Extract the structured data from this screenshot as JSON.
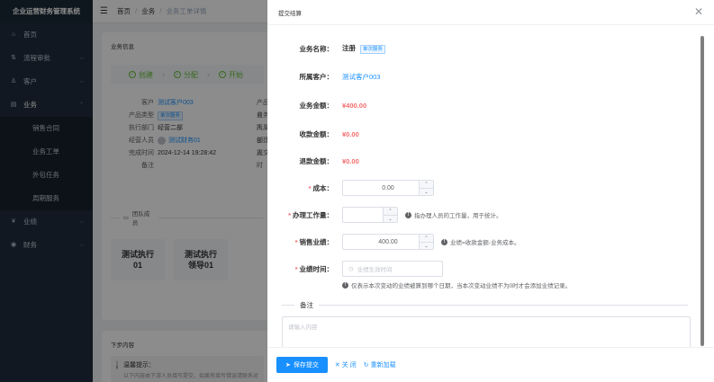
{
  "sidebar": {
    "brand": "企业运营财务管理系统",
    "items": [
      {
        "icon": "⌂",
        "label": "首页"
      },
      {
        "icon": "⇅",
        "label": "流程审批"
      },
      {
        "icon": "♙",
        "label": "客户"
      },
      {
        "icon": "▤",
        "label": "业务"
      }
    ],
    "sub_items": [
      "销售合同",
      "业务工单",
      "外包任务",
      "周期服务"
    ],
    "bottom_items": [
      {
        "icon": "¥",
        "label": "业绩"
      },
      {
        "icon": "◉",
        "label": "财务"
      }
    ]
  },
  "topbar": {
    "crumbs": [
      "首页",
      "业务",
      "业务工单详情"
    ]
  },
  "detail": {
    "section_title": "业务信息",
    "steps": [
      "创建",
      "分配",
      "开始"
    ],
    "rows": [
      {
        "label": "客户",
        "value": "测试客户003"
      },
      {
        "label": "产品类型",
        "value": "单次服务"
      },
      {
        "label": "执行部门",
        "value": "经营二部"
      },
      {
        "label": "经营人员",
        "value": "测试财务01"
      },
      {
        "label": "完成时间",
        "value": "2024-12-14 19:28:42"
      },
      {
        "label": "备注",
        "value": ""
      }
    ],
    "right_labels": [
      "产品名",
      "业务人",
      "所属部",
      "创建人",
      "提交时"
    ],
    "team_title": "团队成员",
    "team": [
      {
        "line1": "测试执行",
        "line2": "01"
      },
      {
        "line1": "测试执行",
        "line2": "领导01"
      }
    ],
    "next_title": "下步内容",
    "notice_title": "温馨提示：",
    "notice_text": "以下内容由下游人员填写提交，如果有填写错误请联系对应人员修改"
  },
  "drawer": {
    "title": "提交结算",
    "fields": {
      "biz_name_label": "业务名称：",
      "biz_name": "注册",
      "biz_tag": "单次服务",
      "customer_label": "所属客户：",
      "customer": "测试客户003",
      "biz_amount_label": "业务金额：",
      "biz_amount": "¥400.00",
      "received_label": "收款金额：",
      "received": "¥0.00",
      "refund_label": "退款金额：",
      "refund": "¥0.00",
      "cost_label": "成本：",
      "cost_value": "0.00",
      "workload_label": "办理工作量：",
      "workload_value": "",
      "workload_hint": "指办理人员的工作量，用于统计。",
      "sales_label": "销售业绩：",
      "sales_value": "400.00",
      "sales_hint": "业绩=收款金额-业务成本。",
      "time_label": "业绩时间：",
      "time_placeholder": "业绩生效时间",
      "time_hint": "仅表示本次变动的业绩被算到哪个日期，当本次变动业绩不为0时才会添加业绩记录。"
    },
    "remark_label": "备注",
    "remark_placeholder": "请输入内容",
    "footer": {
      "submit": "保存提交",
      "close": "关 闭",
      "reload": "重新加载"
    }
  }
}
